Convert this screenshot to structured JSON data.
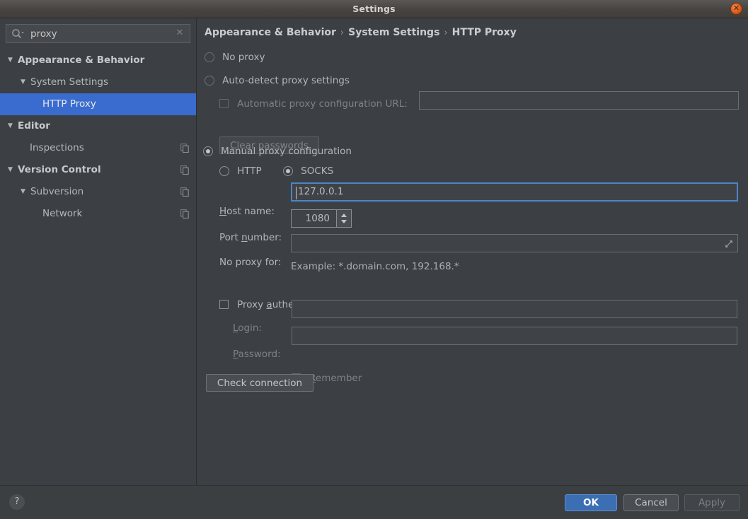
{
  "window": {
    "title": "Settings",
    "close_icon": "close-icon"
  },
  "sidebar": {
    "search": {
      "value": "proxy",
      "placeholder": "",
      "search_icon": "search-icon",
      "clear_icon": "clear-icon"
    },
    "items": [
      {
        "label": "Appearance & Behavior",
        "twisty": "▼",
        "indent": 8,
        "bold": true,
        "selected": false,
        "copy": false
      },
      {
        "label": "System Settings",
        "twisty": "▼",
        "indent": 26,
        "bold": false,
        "selected": false,
        "copy": false
      },
      {
        "label": "HTTP Proxy",
        "twisty": "",
        "indent": 60,
        "bold": false,
        "selected": true,
        "copy": false
      },
      {
        "label": "Editor",
        "twisty": "▼",
        "indent": 8,
        "bold": true,
        "selected": false,
        "copy": false
      },
      {
        "label": "Inspections",
        "twisty": "",
        "indent": 42,
        "bold": false,
        "selected": false,
        "copy": true
      },
      {
        "label": "Version Control",
        "twisty": "▼",
        "indent": 8,
        "bold": true,
        "selected": false,
        "copy": true
      },
      {
        "label": "Subversion",
        "twisty": "▼",
        "indent": 26,
        "bold": false,
        "selected": false,
        "copy": true
      },
      {
        "label": "Network",
        "twisty": "",
        "indent": 60,
        "bold": false,
        "selected": false,
        "copy": true
      }
    ]
  },
  "breadcrumb": {
    "part1": "Appearance & Behavior",
    "sep1": "›",
    "part2": "System Settings",
    "sep2": "›",
    "part3": "HTTP Proxy"
  },
  "proxy": {
    "no_proxy_label": "No proxy",
    "no_proxy_selected": false,
    "auto_detect_label": "Auto-detect proxy settings",
    "auto_detect_selected": false,
    "auto_url_label_pre": "",
    "auto_url_label": "Automatic proxy configuration URL:",
    "auto_url_checked": false,
    "auto_url_value": "",
    "clear_passwords_label": "Clear passwords",
    "manual_label": "Manual proxy configuration",
    "manual_selected": true,
    "http_label": "HTTP",
    "http_selected": false,
    "socks_label": "SOCKS",
    "socks_selected": true,
    "host_label_mn": "H",
    "host_label_rest": "ost name:",
    "host_value": "127.0.0.1",
    "port_label_pre": "Port ",
    "port_label_mn": "n",
    "port_label_rest": "umber:",
    "port_value": "1080",
    "noproxy_label": "No proxy for:",
    "noproxy_value": "",
    "expand_icon": "expand-icon",
    "example_text": "Example: *.domain.com, 192.168.*",
    "auth_label_pre": "Proxy ",
    "auth_label_mn": "a",
    "auth_label_rest": "uthentication",
    "auth_checked": false,
    "login_label_mn": "L",
    "login_label_rest": "ogin:",
    "login_value": "",
    "password_label_mn": "P",
    "password_label_rest": "assword:",
    "password_value": "",
    "remember_label_mn": "R",
    "remember_label_rest": "emember",
    "remember_checked": false,
    "check_connection_label": "Check connection"
  },
  "footer": {
    "help_label": "?",
    "ok_label": "OK",
    "cancel_label": "Cancel",
    "apply_label": "Apply"
  },
  "colors": {
    "accent_selection": "#3a6ccf",
    "primary_button": "#3c6eb4",
    "focus_border": "#4a86c8",
    "panel_bg": "#3c4044",
    "window_bg": "#3c3f41"
  }
}
